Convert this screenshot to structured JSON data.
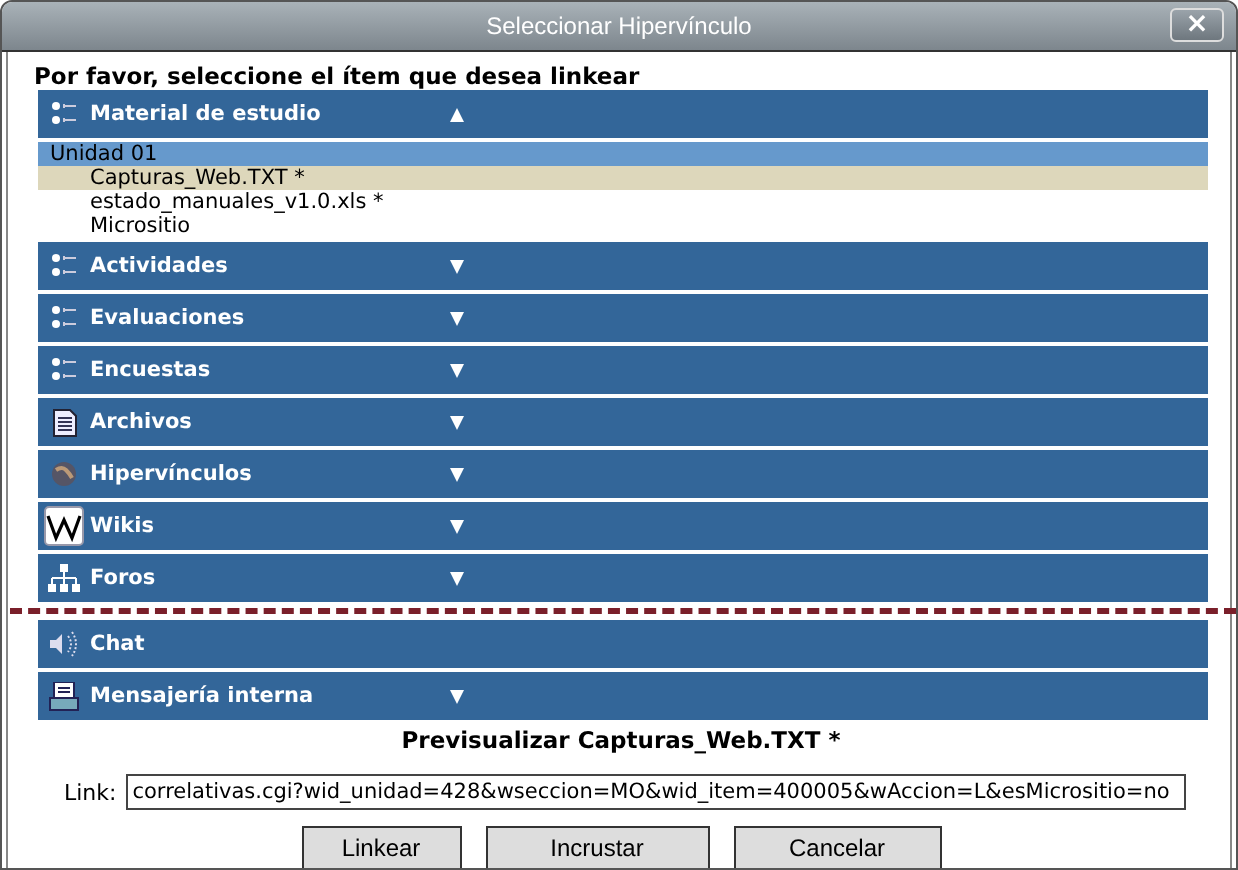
{
  "window": {
    "title": "Seleccionar Hipervínculo",
    "close": "×"
  },
  "prompt": "Por favor, seleccione el ítem que desea linkear",
  "sections": [
    {
      "label": "Material de estudio",
      "kind": "list",
      "expanded": true,
      "collapsible": true,
      "groups": [
        {
          "label": "Unidad 01",
          "items": [
            {
              "label": "Capturas_Web.TXT *",
              "selected": true
            },
            {
              "label": "estado_manuales_v1.0.xls *",
              "selected": false
            },
            {
              "label": "Micrositio",
              "selected": false
            }
          ]
        }
      ]
    },
    {
      "label": "Actividades",
      "kind": "list",
      "expanded": false,
      "collapsible": true
    },
    {
      "label": "Evaluaciones",
      "kind": "list",
      "expanded": false,
      "collapsible": true
    },
    {
      "label": "Encuestas",
      "kind": "list",
      "expanded": false,
      "collapsible": true
    },
    {
      "label": "Archivos",
      "kind": "document",
      "expanded": false,
      "collapsible": true
    },
    {
      "label": "Hipervínculos",
      "kind": "globe",
      "expanded": false,
      "collapsible": true
    },
    {
      "label": "Wikis",
      "kind": "wiki",
      "expanded": false,
      "collapsible": true
    },
    {
      "label": "Foros",
      "kind": "tree",
      "expanded": false,
      "collapsible": true,
      "tear_after": true
    },
    {
      "label": "Chat",
      "kind": "speaker",
      "collapsible": false
    },
    {
      "label": "Mensajería interna",
      "kind": "mail",
      "expanded": false,
      "collapsible": true
    }
  ],
  "preview": "Previsualizar Capturas_Web.TXT *",
  "link": {
    "label": "Link:",
    "value": "correlativas.cgi?wid_unidad=428&wseccion=MO&wid_item=400005&wAccion=L&esMicrositio=no"
  },
  "buttons": [
    "Linkear",
    "Incrustar",
    "Cancelar"
  ]
}
